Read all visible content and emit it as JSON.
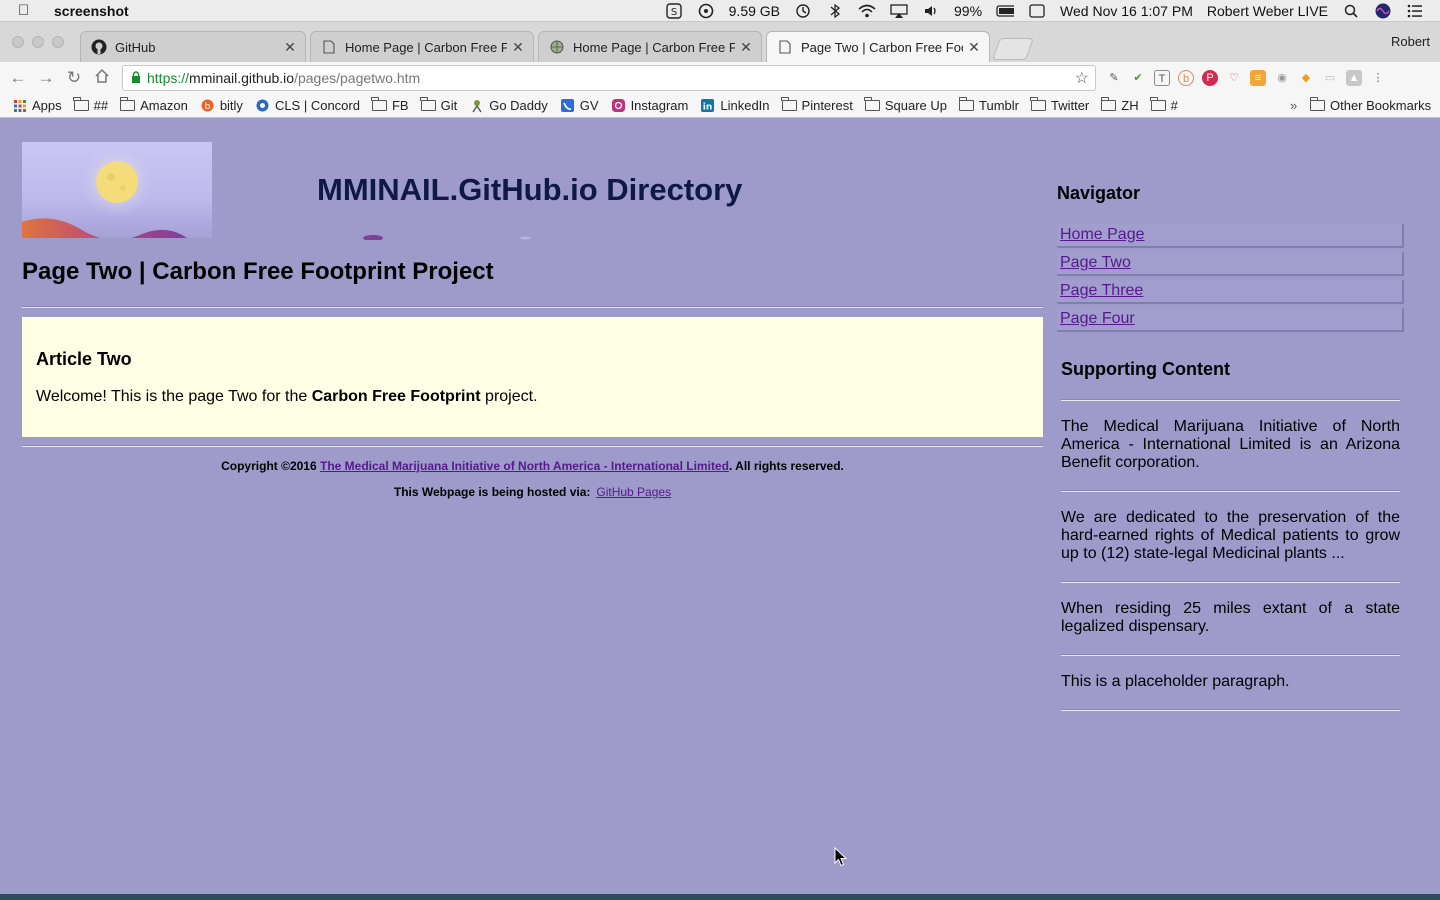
{
  "menubar": {
    "app_name": "screenshot",
    "disk": "9.59 GB",
    "battery": "99%",
    "datetime": "Wed Nov 16  1:07 PM",
    "user": "Robert Weber LIVE"
  },
  "tabs": [
    {
      "title": "GitHub",
      "favicon": "github-icon"
    },
    {
      "title": "Home Page | Carbon Free Foot",
      "favicon": "page-icon"
    },
    {
      "title": "Home Page | Carbon Free Foot",
      "favicon": "globe-icon"
    },
    {
      "title": "Page Two | Carbon Free Footp",
      "favicon": "page-icon"
    }
  ],
  "profile_name": "Robert",
  "url": {
    "scheme": "https://",
    "host": "mminail.github.io",
    "path": "/pages/pagetwo.htm"
  },
  "bookmarks": [
    "Apps",
    "##",
    "Amazon",
    "bitly",
    "CLS | Concord",
    "FB",
    "Git",
    "Go Daddy",
    "GV",
    "Instagram",
    "LinkedIn",
    "Pinterest",
    "Square Up",
    "Tumblr",
    "Twitter",
    "ZH",
    "#"
  ],
  "bookmarks_overflow": "»",
  "other_bookmarks": "Other Bookmarks",
  "page": {
    "site_title": "MMINAIL.GitHub.io Directory",
    "heading": "Page Two | Carbon Free Footprint Project",
    "article": {
      "title": "Article Two",
      "text_before": "Welcome! This is the page Two for the ",
      "text_bold": "Carbon Free Footprint",
      "text_after": " project."
    },
    "footer": {
      "copyright_prefix": "Copyright ©2016 ",
      "org_link": "The Medical Marijuana Initiative of North America - International Limited",
      "copyright_suffix": ". All rights reserved.",
      "hosted_text": "This Webpage is being hosted via:",
      "hosted_link": "GitHub Pages"
    }
  },
  "sidebar": {
    "nav_title": "Navigator",
    "nav_items": [
      "Home Page",
      "Page Two",
      "Page Three",
      "Page Four"
    ],
    "support_title": "Supporting Content",
    "paragraphs": [
      "The Medical Marijuana Initiative of North America - International Limited is an Arizona Benefit corporation.",
      "We are dedicated to the preservation of the hard-earned rights of Medical patients to grow up to (12) state-legal Medicinal plants ...",
      "When residing 25 miles extant of a state legalized dispensary.",
      "This is a placeholder paragraph."
    ]
  },
  "colors": {
    "page_bg": "#9e9bca",
    "article_bg": "#ffffe5",
    "link": "#551a8b",
    "title": "#0f1846"
  }
}
